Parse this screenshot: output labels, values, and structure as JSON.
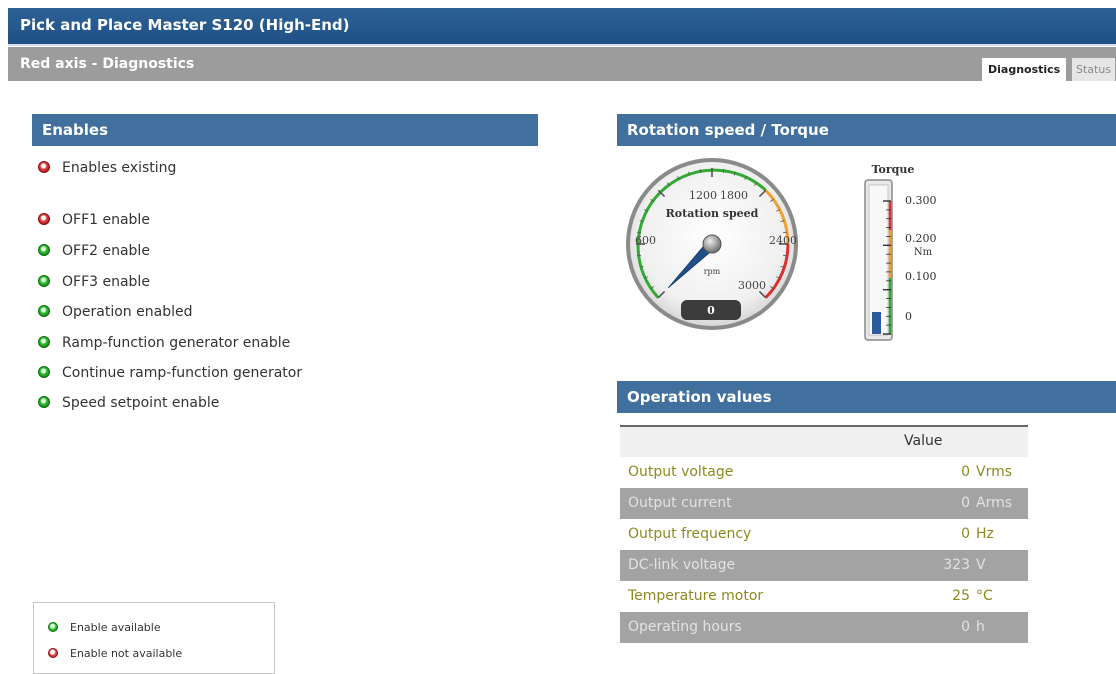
{
  "app": {
    "title": "Pick and Place Master S120 (High-End)",
    "subtitle": "Red axis - Diagnostics"
  },
  "tabs": [
    {
      "label": "Diagnostics",
      "active": true
    },
    {
      "label": "Status",
      "active": false
    }
  ],
  "enables": {
    "header": "Enables",
    "items": [
      {
        "label": "Enables existing",
        "status": "red"
      },
      {
        "label": "OFF1 enable",
        "status": "red"
      },
      {
        "label": "OFF2 enable",
        "status": "green"
      },
      {
        "label": "OFF3 enable",
        "status": "green"
      },
      {
        "label": "Operation enabled",
        "status": "green"
      },
      {
        "label": "Ramp-function generator enable",
        "status": "green"
      },
      {
        "label": "Continue ramp-function generator",
        "status": "green"
      },
      {
        "label": "Speed setpoint enable",
        "status": "green"
      }
    ]
  },
  "legend": {
    "available": "Enable available",
    "not_available": "Enable not available"
  },
  "rotation": {
    "header": "Rotation speed / Torque",
    "gauge": {
      "title": "Rotation speed",
      "unit": "rpm",
      "ticks": [
        "600",
        "1200",
        "1800",
        "2400",
        "3000"
      ],
      "value": 0,
      "value_display": "0",
      "max": 3600
    },
    "torque": {
      "title": "Torque",
      "unit": "Nm",
      "ticks": [
        "0.300",
        "0.200",
        "0.100",
        "0"
      ],
      "max": 0.35,
      "value": 0
    }
  },
  "operation": {
    "header": "Operation values",
    "col_value": "Value",
    "rows": [
      {
        "name": "Output voltage",
        "value": "0",
        "unit": "Vrms"
      },
      {
        "name": "Output current",
        "value": "0",
        "unit": "Arms"
      },
      {
        "name": "Output frequency",
        "value": "0",
        "unit": "Hz"
      },
      {
        "name": "DC-link voltage",
        "value": "323",
        "unit": "V"
      },
      {
        "name": "Temperature motor",
        "value": "25",
        "unit": "°C"
      },
      {
        "name": "Operating hours",
        "value": "0",
        "unit": "h"
      }
    ]
  },
  "colors": {
    "header_blue": "#416f9e",
    "title_blue": "#1f5086",
    "led_red": "#d62b2b",
    "led_green": "#2bb22b",
    "row_value_text": "#8b8b1e"
  }
}
